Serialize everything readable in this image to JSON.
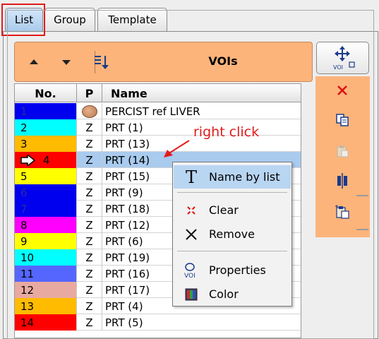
{
  "tabs": [
    {
      "label": "List",
      "active": true
    },
    {
      "label": "Group",
      "active": false
    },
    {
      "label": "Template",
      "active": false
    }
  ],
  "header": {
    "title": "VOIs",
    "icons": [
      "move-up-icon",
      "move-down-icon",
      "sort-icon"
    ]
  },
  "side_toolbar": {
    "top_button_label": "VOI",
    "icons": [
      "clear-icon",
      "copy-icon",
      "paste-icon",
      "split-icon",
      "paste-special-icon"
    ]
  },
  "table": {
    "columns": [
      "No.",
      "P",
      "Name"
    ],
    "rows": [
      {
        "no": "1",
        "p": "",
        "name": "PERCIST ref LIVER",
        "color": "#0000ee",
        "text_color": "#2a2aa0",
        "liver": true
      },
      {
        "no": "2",
        "p": "Z",
        "name": "PRT (1)",
        "color": "#00ffff"
      },
      {
        "no": "3",
        "p": "Z",
        "name": "PRT (13)",
        "color": "#ffbb00"
      },
      {
        "no": "4",
        "p": "Z",
        "name": "PRT (14)",
        "color": "#ff0000",
        "selected": true,
        "cursor": true
      },
      {
        "no": "5",
        "p": "Z",
        "name": "PRT (15)",
        "color": "#ffff00"
      },
      {
        "no": "6",
        "p": "Z",
        "name": "PRT (9)",
        "color": "#0000ee",
        "text_color": "#2a2aa0"
      },
      {
        "no": "7",
        "p": "Z",
        "name": "PRT (18)",
        "color": "#0000ee",
        "text_color": "#2a2aa0"
      },
      {
        "no": "8",
        "p": "Z",
        "name": "PRT (12)",
        "color": "#ff00ff"
      },
      {
        "no": "9",
        "p": "Z",
        "name": "PRT (6)",
        "color": "#ffff00"
      },
      {
        "no": "10",
        "p": "Z",
        "name": "PRT (19)",
        "color": "#00ffff"
      },
      {
        "no": "11",
        "p": "Z",
        "name": "PRT (16)",
        "color": "#5566ff"
      },
      {
        "no": "12",
        "p": "Z",
        "name": "PRT (17)",
        "color": "#e8aaa0"
      },
      {
        "no": "13",
        "p": "Z",
        "name": "PRT (4)",
        "color": "#ffbb00"
      },
      {
        "no": "14",
        "p": "Z",
        "name": "PRT (5)",
        "color": "#ff0000"
      }
    ]
  },
  "annotation": {
    "text": "right click",
    "color": "#e21b1b"
  },
  "context_menu": {
    "items": [
      {
        "label": "Name by list",
        "icon": "text-t-icon"
      },
      {
        "label": "Clear",
        "icon": "clear-icon"
      },
      {
        "label": "Remove",
        "icon": "remove-x-icon"
      },
      {
        "label": "Properties",
        "icon": "voi-properties-icon"
      },
      {
        "label": "Color",
        "icon": "color-icon"
      }
    ]
  },
  "colors": {
    "accent_orange": "#fdb47b",
    "selection_blue": "#a9cbee",
    "menu_hover": "#b8d5f2",
    "highlight_red": "#e21b1b"
  }
}
